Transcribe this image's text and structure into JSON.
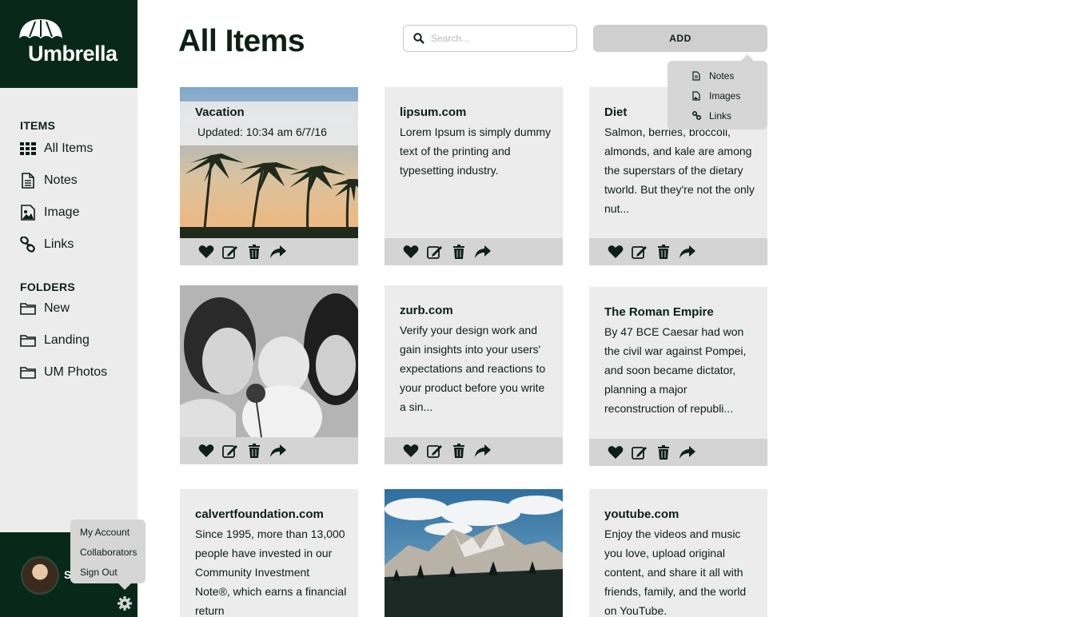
{
  "app": {
    "brand": "Umbrella"
  },
  "sidebar": {
    "items_header": "ITEMS",
    "items": [
      {
        "label": "All Items",
        "icon": "grid-icon"
      },
      {
        "label": "Notes",
        "icon": "document-icon"
      },
      {
        "label": "Image",
        "icon": "image-icon"
      },
      {
        "label": "Links",
        "icon": "link-icon"
      }
    ],
    "folders_header": "FOLDERS",
    "folders": [
      {
        "label": "New",
        "icon": "folder-icon"
      },
      {
        "label": "Landing",
        "icon": "folder-icon"
      },
      {
        "label": "UM Photos",
        "icon": "folder-icon"
      }
    ],
    "user_initial": "S"
  },
  "account_menu": [
    "My Account",
    "Collaborators",
    "Sign Out"
  ],
  "header": {
    "title": "All Items",
    "search_placeholder": "Search...",
    "add_label": "ADD"
  },
  "add_menu": [
    {
      "label": "Notes",
      "icon": "document-icon"
    },
    {
      "label": "Images",
      "icon": "image-icon"
    },
    {
      "label": "Links",
      "icon": "link-icon"
    }
  ],
  "cards": [
    {
      "title": "Vacation",
      "body": "Updated: 10:34 am 6/7/16",
      "type": "image",
      "image": "palm-trees"
    },
    {
      "title": "lipsum.com",
      "body": "Lorem Ipsum is simply dummy text of the printing and typesetting industry.",
      "type": "link"
    },
    {
      "title": "Diet",
      "body": "Salmon, berries, broccoli, almonds, and kale are among the superstars of the dietary tworld. But they're not the only nut...",
      "type": "note"
    },
    {
      "title": "",
      "body": "",
      "type": "image",
      "image": "family-photo"
    },
    {
      "title": "zurb.com",
      "body": "Verify your design work and gain insights into your users' expectations and reactions to your product before you write a sin...",
      "type": "link"
    },
    {
      "title": "The Roman Empire",
      "body": "By 47 BCE Caesar had won the civil war against Pompei, and soon became dictator, planning a major reconstruction of republi...",
      "type": "note"
    },
    {
      "title": "calvertfoundation.com",
      "body": "Since 1995, more than 13,000 people have invested in our Community Investment Note®, which earns a financial return",
      "type": "link"
    },
    {
      "title": "",
      "body": "",
      "type": "image",
      "image": "mountain-landscape"
    },
    {
      "title": "youtube.com",
      "body": "Enjoy the videos and music you love, upload original content, and share it all with friends, family, and the world on YouTube.",
      "type": "link"
    }
  ],
  "card_actions": [
    "heart-icon",
    "edit-icon",
    "trash-icon",
    "share-icon"
  ],
  "colors": {
    "brand_dark": "#08291a",
    "sidebar_bg": "#ececec",
    "card_bg": "#ececec",
    "action_bar": "#d4d4d4"
  }
}
